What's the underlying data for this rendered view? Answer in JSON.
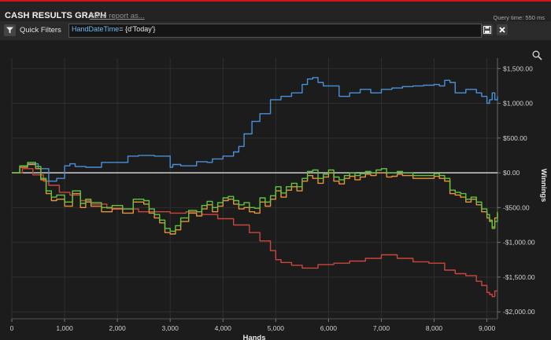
{
  "header": {
    "title": "CASH RESULTS GRAPH",
    "save_link": "Save report as...",
    "query_time": "Query time: 550 ms"
  },
  "filters": {
    "label": "Quick Filters",
    "query_key": "HandDateTime",
    "query_rest": "= {d'Today'}",
    "icons": [
      "filter-icon",
      "save-icon",
      "close-icon"
    ]
  },
  "toolbar_icons": [
    "zoom-icon"
  ],
  "chart_data": {
    "type": "line",
    "xlabel": "Hands",
    "ylabel": "Winnings",
    "xlim": [
      0,
      9200
    ],
    "ylim": [
      -2100,
      1650
    ],
    "xticks": [
      0,
      1000,
      2000,
      3000,
      4000,
      5000,
      6000,
      7000,
      8000,
      9000
    ],
    "xtick_labels": [
      "0",
      "1,000",
      "2,000",
      "3,000",
      "4,000",
      "5,000",
      "6,000",
      "7,000",
      "8,000",
      "9,000"
    ],
    "yticks": [
      1500,
      1000,
      500,
      0,
      -500,
      -1000,
      -1500,
      -2000
    ],
    "ytick_labels": [
      "$1,500.00",
      "$1,000.00",
      "$500.00",
      "$0.00",
      "-$500.00",
      "-$1,000.00",
      "-$1,500.00",
      "-$2,000.00"
    ],
    "grid": true,
    "colors": {
      "blue": "#4a8fd8",
      "red": "#c9463c",
      "orange": "#e8903a",
      "green": "#5cc63e",
      "zero_line": "#dddddd"
    },
    "series": [
      {
        "color": "blue",
        "x": [
          0,
          150,
          300,
          500,
          700,
          850,
          1000,
          1100,
          1200,
          1400,
          1700,
          2000,
          2200,
          2400,
          2700,
          3000,
          3050,
          3200,
          3500,
          3700,
          3800,
          4000,
          4200,
          4300,
          4400,
          4550,
          4700,
          4900,
          5100,
          5300,
          5500,
          5600,
          5700,
          5800,
          5900,
          6000,
          6200,
          6400,
          6600,
          6800,
          7000,
          7200,
          7400,
          7600,
          7800,
          8000,
          8100,
          8200,
          8300,
          8400,
          8500,
          8600,
          8800,
          8900,
          9000,
          9050,
          9100,
          9150,
          9200
        ],
        "y": [
          0,
          100,
          130,
          60,
          -120,
          -80,
          100,
          130,
          90,
          80,
          150,
          150,
          240,
          250,
          240,
          80,
          120,
          100,
          160,
          150,
          200,
          240,
          300,
          380,
          560,
          740,
          850,
          1050,
          1100,
          1150,
          1270,
          1350,
          1370,
          1300,
          1250,
          1250,
          1100,
          1150,
          1200,
          1150,
          1200,
          1220,
          1240,
          1250,
          1260,
          1270,
          1250,
          1330,
          1300,
          1150,
          1150,
          1200,
          1150,
          1100,
          1000,
          1050,
          1150,
          1050,
          1100
        ]
      },
      {
        "color": "red",
        "x": [
          0,
          200,
          400,
          600,
          700,
          900,
          1100,
          1300,
          1500,
          1800,
          2100,
          2400,
          2700,
          3000,
          3300,
          3600,
          3900,
          4200,
          4500,
          4700,
          4900,
          5000,
          5100,
          5300,
          5500,
          5800,
          6100,
          6400,
          6700,
          7000,
          7300,
          7600,
          7900,
          8200,
          8400,
          8600,
          8800,
          8900,
          9000,
          9050,
          9100,
          9150,
          9200
        ],
        "y": [
          0,
          60,
          -30,
          -120,
          -180,
          -280,
          -320,
          -400,
          -450,
          -510,
          -520,
          -560,
          -560,
          -580,
          -560,
          -600,
          -660,
          -750,
          -860,
          -980,
          -1120,
          -1250,
          -1290,
          -1330,
          -1370,
          -1320,
          -1300,
          -1270,
          -1230,
          -1180,
          -1230,
          -1280,
          -1300,
          -1400,
          -1450,
          -1480,
          -1560,
          -1620,
          -1720,
          -1750,
          -1780,
          -1700,
          -1700
        ]
      },
      {
        "color": "orange",
        "x": [
          0,
          150,
          300,
          450,
          550,
          650,
          750,
          850,
          1000,
          1150,
          1300,
          1400,
          1500,
          1700,
          1900,
          2100,
          2300,
          2500,
          2600,
          2700,
          2800,
          2900,
          3000,
          3100,
          3200,
          3350,
          3500,
          3600,
          3700,
          3800,
          3900,
          4000,
          4100,
          4200,
          4300,
          4400,
          4500,
          4600,
          4700,
          4800,
          4900,
          5000,
          5100,
          5200,
          5300,
          5400,
          5500,
          5600,
          5700,
          5800,
          5900,
          6000,
          6100,
          6200,
          6300,
          6400,
          6500,
          6600,
          6700,
          6800,
          6900,
          7000,
          7100,
          7200,
          7300,
          7400,
          7500,
          7600,
          7700,
          7800,
          7900,
          8000,
          8100,
          8200,
          8300,
          8400,
          8500,
          8600,
          8700,
          8800,
          8900,
          9000,
          9050,
          9100,
          9150,
          9200
        ],
        "y": [
          0,
          80,
          120,
          60,
          -100,
          -300,
          -400,
          -380,
          -480,
          -300,
          -500,
          -420,
          -480,
          -560,
          -520,
          -580,
          -420,
          -450,
          -580,
          -650,
          -720,
          -860,
          -880,
          -820,
          -700,
          -580,
          -620,
          -520,
          -460,
          -560,
          -480,
          -400,
          -380,
          -450,
          -520,
          -500,
          -560,
          -580,
          -420,
          -480,
          -380,
          -260,
          -350,
          -250,
          -200,
          -260,
          -120,
          -40,
          -80,
          -150,
          -60,
          0,
          -120,
          -160,
          -80,
          -50,
          -100,
          -60,
          -20,
          -40,
          0,
          0,
          -60,
          -50,
          -20,
          -40,
          -40,
          -80,
          -80,
          -80,
          -80,
          -50,
          -80,
          -120,
          -300,
          -320,
          -350,
          -420,
          -380,
          -460,
          -560,
          -650,
          -700,
          -780,
          -650,
          -580
        ]
      },
      {
        "color": "green",
        "x": [
          0,
          150,
          300,
          450,
          550,
          650,
          750,
          850,
          1000,
          1150,
          1300,
          1400,
          1500,
          1700,
          1900,
          2100,
          2300,
          2500,
          2600,
          2700,
          2800,
          2900,
          3000,
          3100,
          3200,
          3350,
          3500,
          3600,
          3700,
          3800,
          3900,
          4000,
          4100,
          4200,
          4300,
          4400,
          4500,
          4600,
          4700,
          4800,
          4900,
          5000,
          5100,
          5200,
          5300,
          5400,
          5500,
          5600,
          5700,
          5800,
          5900,
          6000,
          6100,
          6200,
          6300,
          6400,
          6500,
          6600,
          6700,
          6800,
          6900,
          7000,
          7100,
          7200,
          7300,
          7400,
          7500,
          7600,
          7700,
          7800,
          7900,
          8000,
          8100,
          8200,
          8300,
          8400,
          8500,
          8600,
          8700,
          8800,
          8900,
          9000,
          9050,
          9100,
          9150,
          9200
        ],
        "y": [
          0,
          100,
          150,
          90,
          -80,
          -260,
          -350,
          -320,
          -420,
          -260,
          -440,
          -380,
          -430,
          -500,
          -470,
          -520,
          -380,
          -400,
          -520,
          -600,
          -680,
          -800,
          -840,
          -760,
          -650,
          -540,
          -560,
          -470,
          -410,
          -500,
          -430,
          -360,
          -340,
          -400,
          -460,
          -430,
          -500,
          -510,
          -360,
          -420,
          -330,
          -200,
          -290,
          -200,
          -150,
          -200,
          -80,
          20,
          40,
          -80,
          -20,
          40,
          -60,
          -100,
          -40,
          0,
          -40,
          -10,
          20,
          0,
          40,
          60,
          0,
          0,
          20,
          0,
          0,
          -40,
          -40,
          -40,
          -40,
          -10,
          -40,
          -80,
          -250,
          -280,
          -300,
          -380,
          -350,
          -420,
          -520,
          -600,
          -680,
          -800,
          -700,
          -560
        ]
      }
    ]
  }
}
